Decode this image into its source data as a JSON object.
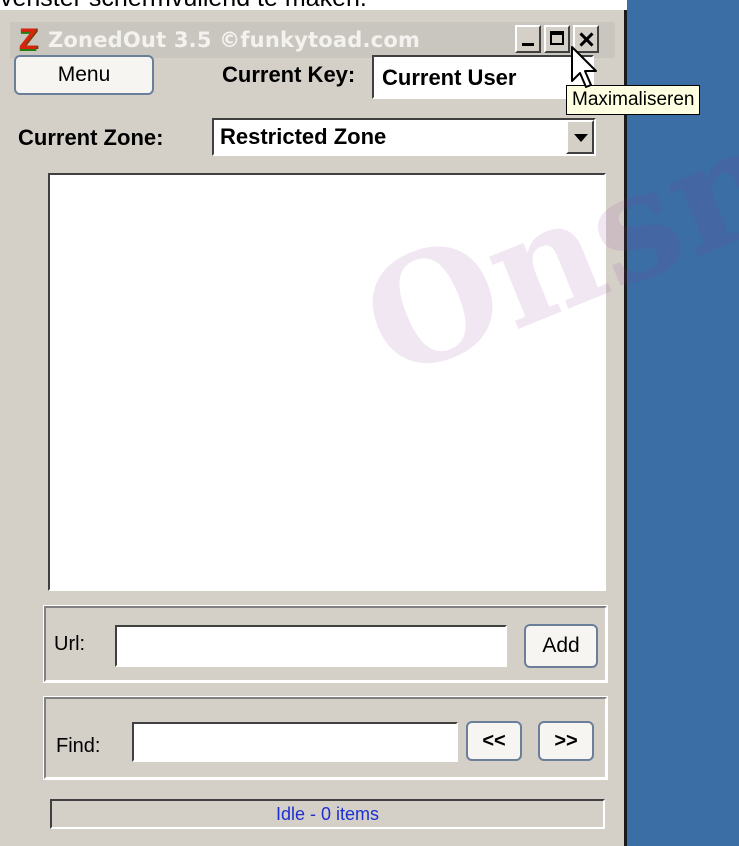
{
  "caption": {
    "text": "venster schermvullend te maken."
  },
  "window": {
    "title": "ZonedOut 3.5  ©funkytoad.com",
    "logo_letter": "Z",
    "titlebar_buttons": [
      "minimize-icon",
      "maximize-icon",
      "close-icon"
    ],
    "tooltip": "Maximaliseren"
  },
  "toolbar": {
    "menu_label": "Menu",
    "current_key_label": "Current Key:",
    "current_key_value": "Current User"
  },
  "zone": {
    "label": "Current Zone:",
    "selected": "Restricted Zone"
  },
  "url_section": {
    "label": "Url:",
    "value": "",
    "add_label": "Add"
  },
  "find_section": {
    "label": "Find:",
    "value": "",
    "prev_label": "<<",
    "next_label": ">>"
  },
  "status": {
    "text": "Idle - 0 items"
  },
  "watermark": {
    "text": "Onsn"
  },
  "colors": {
    "desktop": "#3b6ea5",
    "window_face": "#d4d0c8",
    "status_text": "#1d2fd0",
    "tooltip_bg": "#ffffe1"
  }
}
